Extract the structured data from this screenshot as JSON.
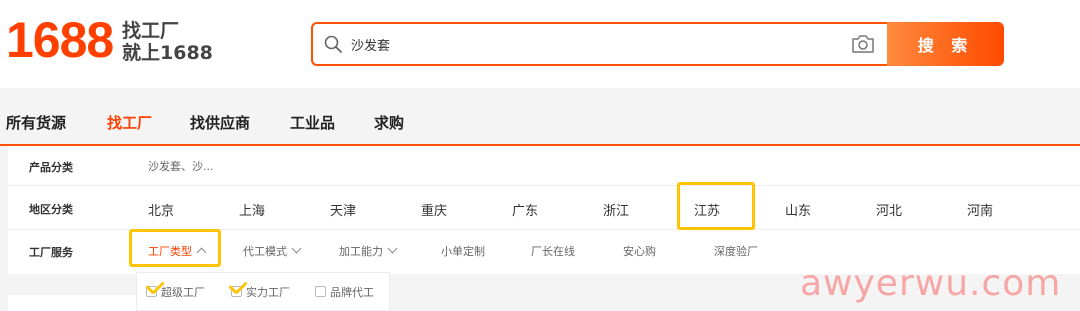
{
  "header": {
    "logo_number": "1688",
    "logo_line1": "找工厂",
    "logo_line2": "就上1688",
    "search": {
      "value": "沙发套",
      "button_label": "搜 索"
    }
  },
  "nav": {
    "tabs": [
      {
        "label": "所有货源",
        "active": false
      },
      {
        "label": "找工厂",
        "active": true
      },
      {
        "label": "找供应商",
        "active": false
      },
      {
        "label": "工业品",
        "active": false
      },
      {
        "label": "求购",
        "active": false
      }
    ]
  },
  "filters": {
    "category": {
      "label": "产品分类",
      "value": "沙发套、沙..."
    },
    "region": {
      "label": "地区分类",
      "items": [
        "北京",
        "上海",
        "天津",
        "重庆",
        "广东",
        "浙江",
        "江苏",
        "山东",
        "河北",
        "河南"
      ],
      "highlighted": "江苏"
    },
    "service": {
      "label": "工厂服务",
      "items": [
        "工厂类型",
        "代工模式",
        "加工能力",
        "小单定制",
        "厂长在线",
        "安心购",
        "深度验厂"
      ],
      "active": "工厂类型"
    },
    "factory_type_options": [
      "超级工厂",
      "实力工厂",
      "品牌代工"
    ]
  },
  "watermark": "awyerwu.com",
  "colors": {
    "brand": "#ff4000",
    "highlight": "#ffc400"
  },
  "icons": {
    "search": "search-icon",
    "camera": "camera-icon",
    "chevron": "chevron-down-icon"
  }
}
